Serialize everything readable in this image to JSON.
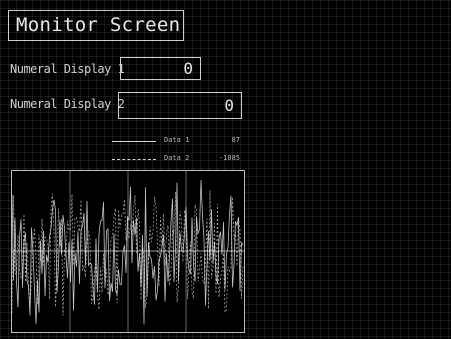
{
  "screen": {
    "title": "Monitor Screen"
  },
  "numeral_displays": [
    {
      "label": "Numeral Display 1",
      "value": "0"
    },
    {
      "label": "Numeral Display 2",
      "value": "0"
    }
  ],
  "legend": [
    {
      "name": "Data 1",
      "value": "87",
      "line_style": "solid"
    },
    {
      "name": "Data 2",
      "value": "-1085",
      "line_style": "dashed"
    }
  ],
  "trend_graph": {
    "series_color": "#e4e4e4",
    "grid_color": "#666666"
  }
}
